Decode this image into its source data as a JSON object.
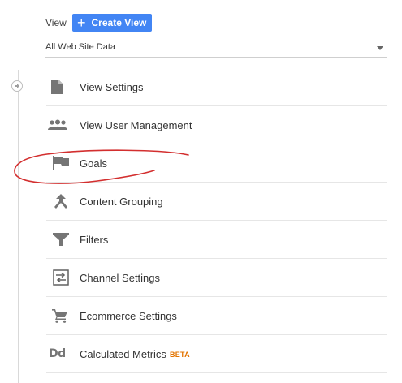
{
  "header": {
    "view_label": "View",
    "create_button_label": "Create View",
    "selected_view": "All Web Site Data"
  },
  "menu": {
    "items": [
      {
        "label": "View Settings",
        "icon": "document-icon"
      },
      {
        "label": "View User Management",
        "icon": "people-icon"
      },
      {
        "label": "Goals",
        "icon": "flag-icon"
      },
      {
        "label": "Content Grouping",
        "icon": "merge-icon"
      },
      {
        "label": "Filters",
        "icon": "filter-icon"
      },
      {
        "label": "Channel Settings",
        "icon": "channel-icon"
      },
      {
        "label": "Ecommerce Settings",
        "icon": "cart-icon"
      },
      {
        "label": "Calculated Metrics",
        "icon": "dd-icon",
        "icon_text": "Dd",
        "badge": "BETA"
      }
    ]
  },
  "colors": {
    "primary_button": "#4285f4",
    "icon_gray": "#757575",
    "beta_badge": "#e37400",
    "annotation_red": "#d32f2f"
  }
}
